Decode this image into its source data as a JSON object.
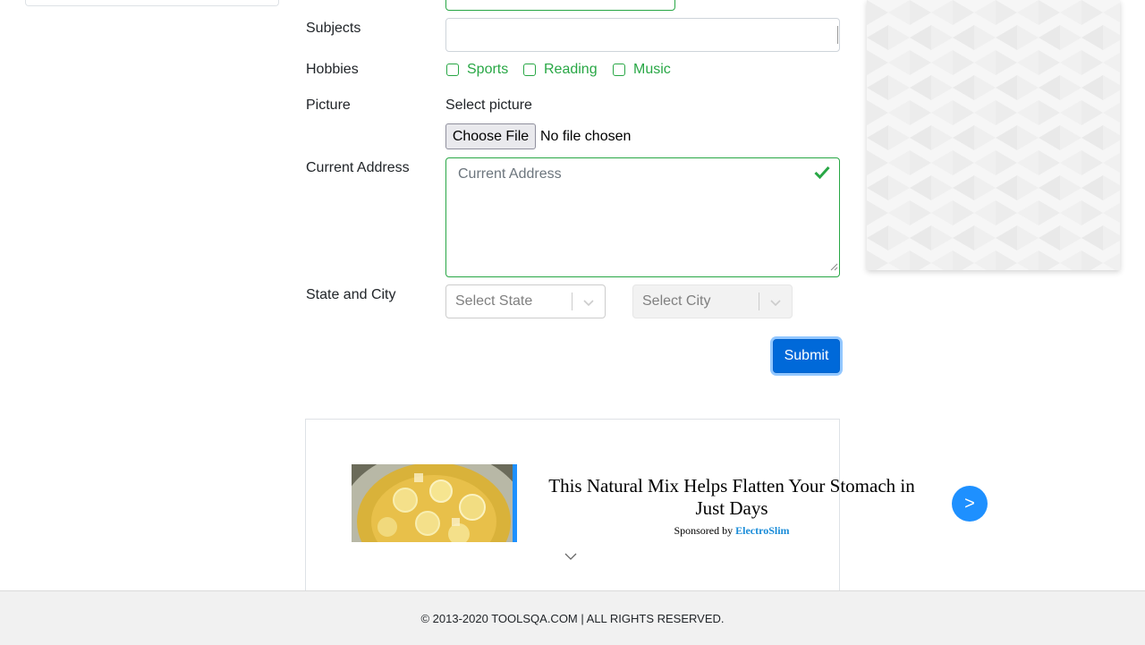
{
  "form": {
    "subjects_label": "Subjects",
    "hobbies_label": "Hobbies",
    "hobbies": [
      "Sports",
      "Reading",
      "Music"
    ],
    "picture_label": "Picture",
    "picture_prompt": "Select picture",
    "choose_file": "Choose File",
    "no_file": "No file chosen",
    "address_label": "Current Address",
    "address_placeholder": "Current Address",
    "state_city_label": "State and City",
    "state_placeholder": "Select State",
    "city_placeholder": "Select City",
    "submit": "Submit"
  },
  "ad": {
    "title": "This Natural Mix Helps Flatten Your Stomach in Just Days",
    "sponsored_by": "Sponsored by",
    "brand": "ElectroSlim",
    "next": ">"
  },
  "footer": {
    "text": "© 2013-2020 TOOLSQA.COM | ALL RIGHTS RESERVED."
  },
  "colors": {
    "valid": "#28a745",
    "primary": "#0069d9",
    "ad_button": "#1e90ff"
  }
}
